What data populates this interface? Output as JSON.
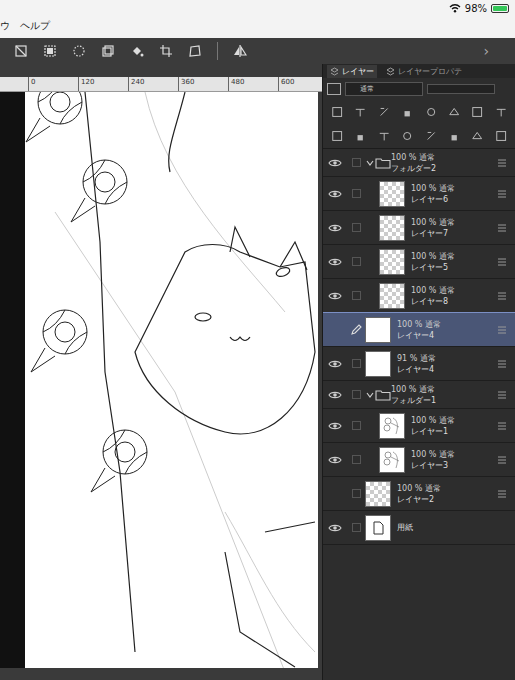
{
  "status_bar": {
    "battery": {
      "reading": "98%",
      "level": 0.98,
      "charging": true
    },
    "wifi": true
  },
  "menu": [
    "ウ",
    "ヘルプ"
  ],
  "panel_arrow": "›",
  "ruler": [
    "0",
    "120",
    "240",
    "360",
    "480",
    "600"
  ],
  "panel_tabs": [
    {
      "label": "レイヤー",
      "selected": true
    },
    {
      "label": "レイヤープロパテ",
      "selected": false
    }
  ],
  "blend_mode": "通常",
  "layers": [
    {
      "name": "フォルダー2",
      "opacity": "100 %",
      "mode": "通常",
      "kind": "folder",
      "visible": true,
      "selected": false,
      "editing": false,
      "expanded": true,
      "depth": 0,
      "thumb": "none"
    },
    {
      "name": "レイヤー6",
      "opacity": "100 %",
      "mode": "通常",
      "kind": "layer",
      "visible": true,
      "selected": false,
      "editing": false,
      "expanded": false,
      "depth": 1,
      "thumb": "transparent"
    },
    {
      "name": "レイヤー7",
      "opacity": "100 %",
      "mode": "通常",
      "kind": "layer",
      "visible": true,
      "selected": false,
      "editing": false,
      "expanded": false,
      "depth": 1,
      "thumb": "transparent"
    },
    {
      "name": "レイヤー5",
      "opacity": "100 %",
      "mode": "通常",
      "kind": "layer",
      "visible": true,
      "selected": false,
      "editing": false,
      "expanded": false,
      "depth": 1,
      "thumb": "transparent"
    },
    {
      "name": "レイヤー8",
      "opacity": "100 %",
      "mode": "通常",
      "kind": "layer",
      "visible": true,
      "selected": false,
      "editing": false,
      "expanded": false,
      "depth": 1,
      "thumb": "transparent"
    },
    {
      "name": "レイヤー4",
      "opacity": "100 %",
      "mode": "通常",
      "kind": "layer",
      "visible": false,
      "selected": true,
      "editing": true,
      "expanded": false,
      "depth": 0,
      "thumb": "white"
    },
    {
      "name": "レイヤー4",
      "opacity": "91 %",
      "mode": "通常",
      "kind": "layer",
      "visible": true,
      "selected": false,
      "editing": false,
      "expanded": false,
      "depth": 0,
      "thumb": "white"
    },
    {
      "name": "フォルダー1",
      "opacity": "100 %",
      "mode": "通常",
      "kind": "folder",
      "visible": true,
      "selected": false,
      "editing": false,
      "expanded": true,
      "depth": 0,
      "thumb": "none"
    },
    {
      "name": "レイヤー1",
      "opacity": "100 %",
      "mode": "通常",
      "kind": "layer",
      "visible": true,
      "selected": false,
      "editing": false,
      "expanded": false,
      "depth": 1,
      "thumb": "sketch"
    },
    {
      "name": "レイヤー3",
      "opacity": "100 %",
      "mode": "通常",
      "kind": "layer",
      "visible": true,
      "selected": false,
      "editing": false,
      "expanded": false,
      "depth": 1,
      "thumb": "sketch"
    },
    {
      "name": "レイヤー2",
      "opacity": "100 %",
      "mode": "通常",
      "kind": "layer",
      "visible": false,
      "selected": false,
      "editing": false,
      "expanded": false,
      "depth": 0,
      "thumb": "transparent"
    },
    {
      "name": "用紙",
      "opacity": "",
      "mode": "",
      "kind": "paper",
      "visible": true,
      "selected": false,
      "editing": false,
      "expanded": false,
      "depth": 0,
      "thumb": "white"
    }
  ]
}
